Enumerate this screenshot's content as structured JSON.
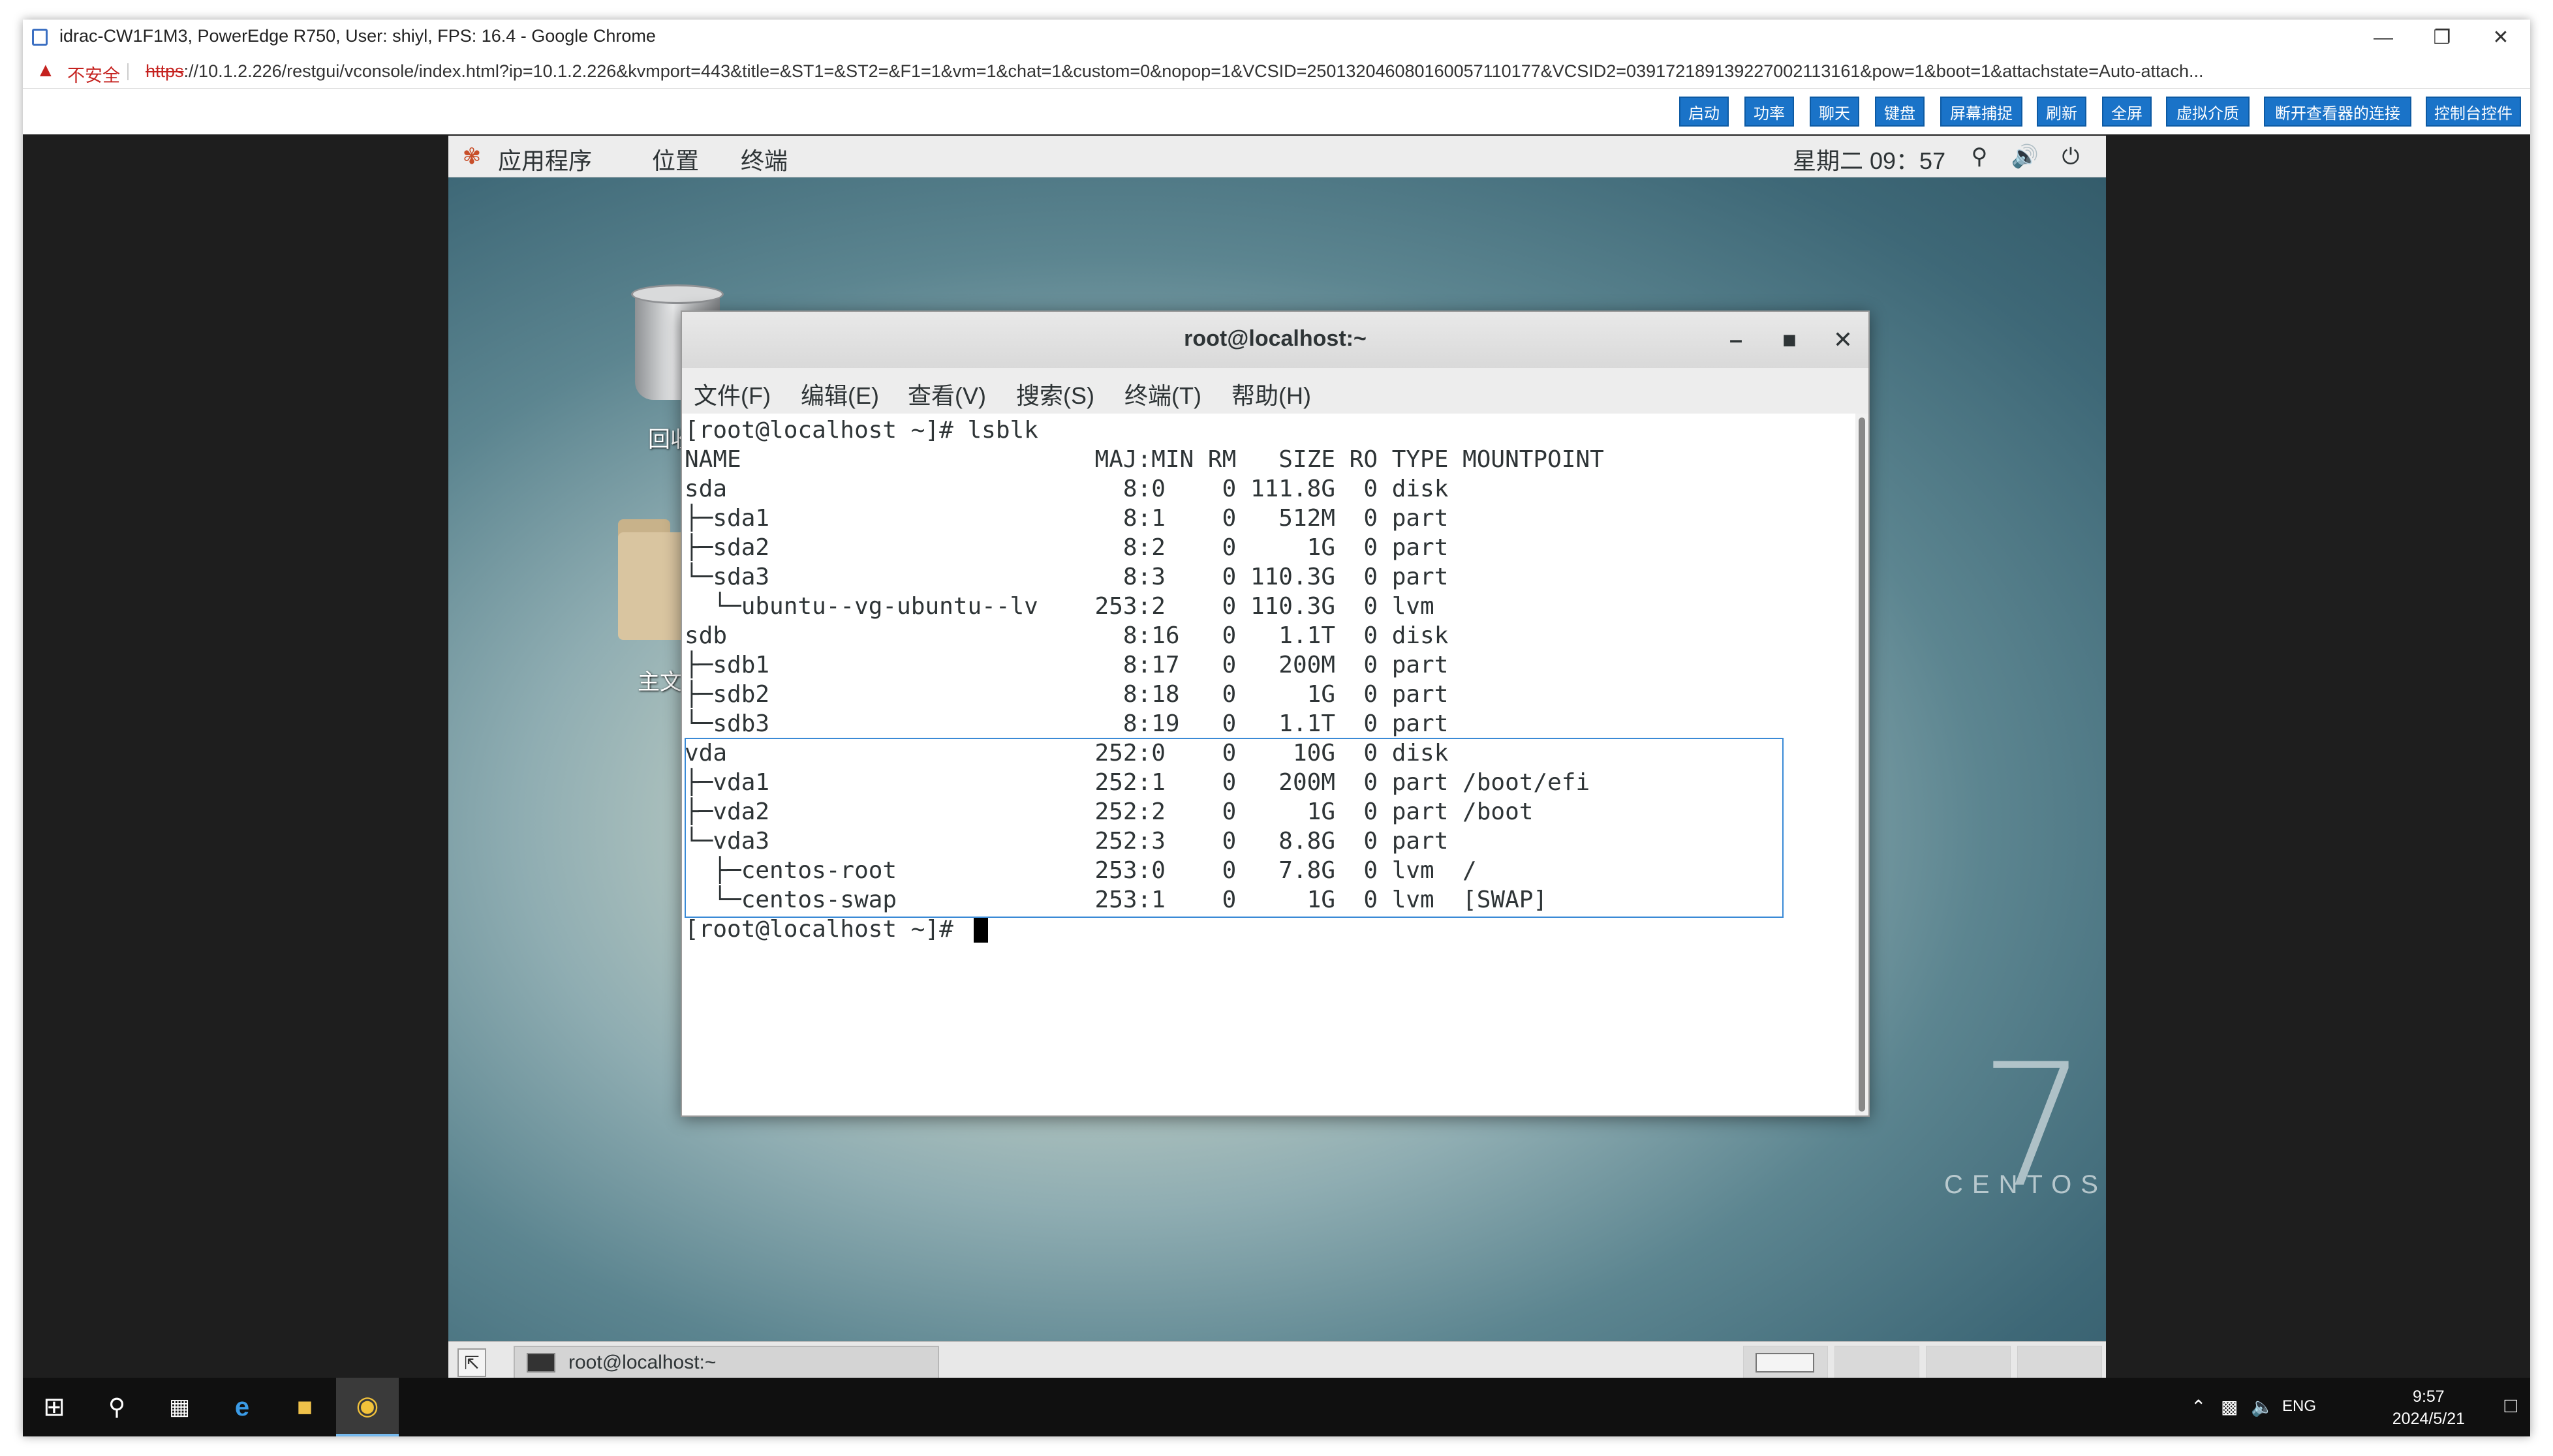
{
  "browser": {
    "title": "idrac-CW1F1M3, PowerEdge R750, User: shiyl, FPS: 16.4 - Google Chrome",
    "insecure_label": "不安全",
    "url_scheme": "https",
    "url_rest": "://10.1.2.226/restgui/vconsole/index.html?ip=10.1.2.226&kvmport=443&title=&ST1=&ST2=&F1=1&vm=1&chat=1&custom=0&nopop=1&VCSID=250132046080160057110177&VCSID2=039172189139227002113161&pow=1&boot=1&attachstate=Auto-attach..."
  },
  "toolbar": {
    "buttons": [
      "启动",
      "功率",
      "聊天",
      "键盘",
      "屏幕捕捉",
      "刷新",
      "全屏",
      "虚拟介质",
      "断开查看器的连接",
      "控制台控件"
    ]
  },
  "gnome_panel": {
    "applications": "应用程序",
    "places": "位置",
    "terminal": "终端",
    "datetime": "星期二 09：57"
  },
  "desktop": {
    "trash_label": "回收",
    "home_label": "主文件"
  },
  "terminal": {
    "title": "root@localhost:~",
    "menu": [
      "文件(F)",
      "编辑(E)",
      "查看(V)",
      "搜索(S)",
      "终端(T)",
      "帮助(H)"
    ],
    "lines": [
      "[root@localhost ~]# lsblk",
      "NAME                         MAJ:MIN RM   SIZE RO TYPE MOUNTPOINT",
      "sda                            8:0    0 111.8G  0 disk",
      "├─sda1                         8:1    0   512M  0 part",
      "├─sda2                         8:2    0     1G  0 part",
      "└─sda3                         8:3    0 110.3G  0 part",
      "  └─ubuntu--vg-ubuntu--lv    253:2    0 110.3G  0 lvm",
      "sdb                            8:16   0   1.1T  0 disk",
      "├─sdb1                         8:17   0   200M  0 part",
      "├─sdb2                         8:18   0     1G  0 part",
      "└─sdb3                         8:19   0   1.1T  0 part",
      "vda                          252:0    0    10G  0 disk",
      "├─vda1                       252:1    0   200M  0 part /boot/efi",
      "├─vda2                       252:2    0     1G  0 part /boot",
      "└─vda3                       252:3    0   8.8G  0 part",
      "  ├─centos-root              253:0    0   7.8G  0 lvm  /",
      "  └─centos-swap              253:1    0     1G  0 lvm  [SWAP]",
      "[root@localhost ~]# "
    ]
  },
  "centos_logo": {
    "number": "7",
    "word": "CENTOS"
  },
  "bottom_panel": {
    "task_label": "root@localhost:~"
  },
  "windows_taskbar": {
    "lang": "ENG",
    "time": "9:57",
    "date": "2024/5/21"
  },
  "colors": {
    "toolbar_button": "#1a73c8",
    "insecure_red": "#c5221f",
    "selection_blue": "#3a8ad6"
  }
}
